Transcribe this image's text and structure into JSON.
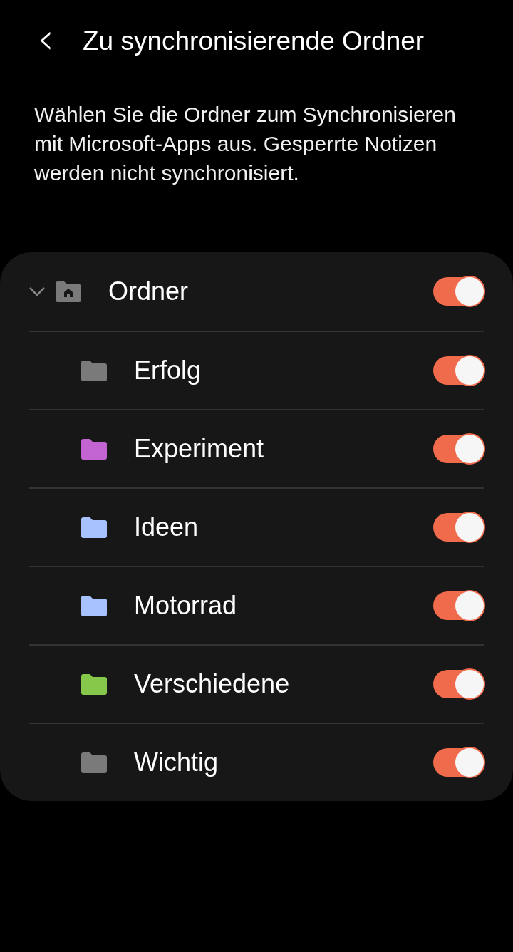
{
  "header": {
    "back": "‹",
    "title": "Zu synchronisierende Ordner"
  },
  "description": "Wählen Sie die Ordner zum Synchronisieren mit Microsoft-Apps aus. Gesperrte Notizen werden nicht synchronisiert.",
  "tree": [
    {
      "label": "Ordner",
      "expanded": true,
      "on": true,
      "children": [
        {
          "label": "Erfolg",
          "color": "#7a7a7a",
          "on": true
        },
        {
          "label": "Experiment",
          "color": "#c264d2",
          "on": true
        },
        {
          "label": "Ideen",
          "color": "#a8c2ff",
          "on": true
        },
        {
          "label": "Motorrad",
          "color": "#a8c2ff",
          "on": true
        },
        {
          "label": "Verschiedene",
          "color": "#86c94a",
          "on": true
        },
        {
          "label": "Wichtig",
          "color": "#7a7a7a",
          "on": true
        }
      ]
    }
  ]
}
